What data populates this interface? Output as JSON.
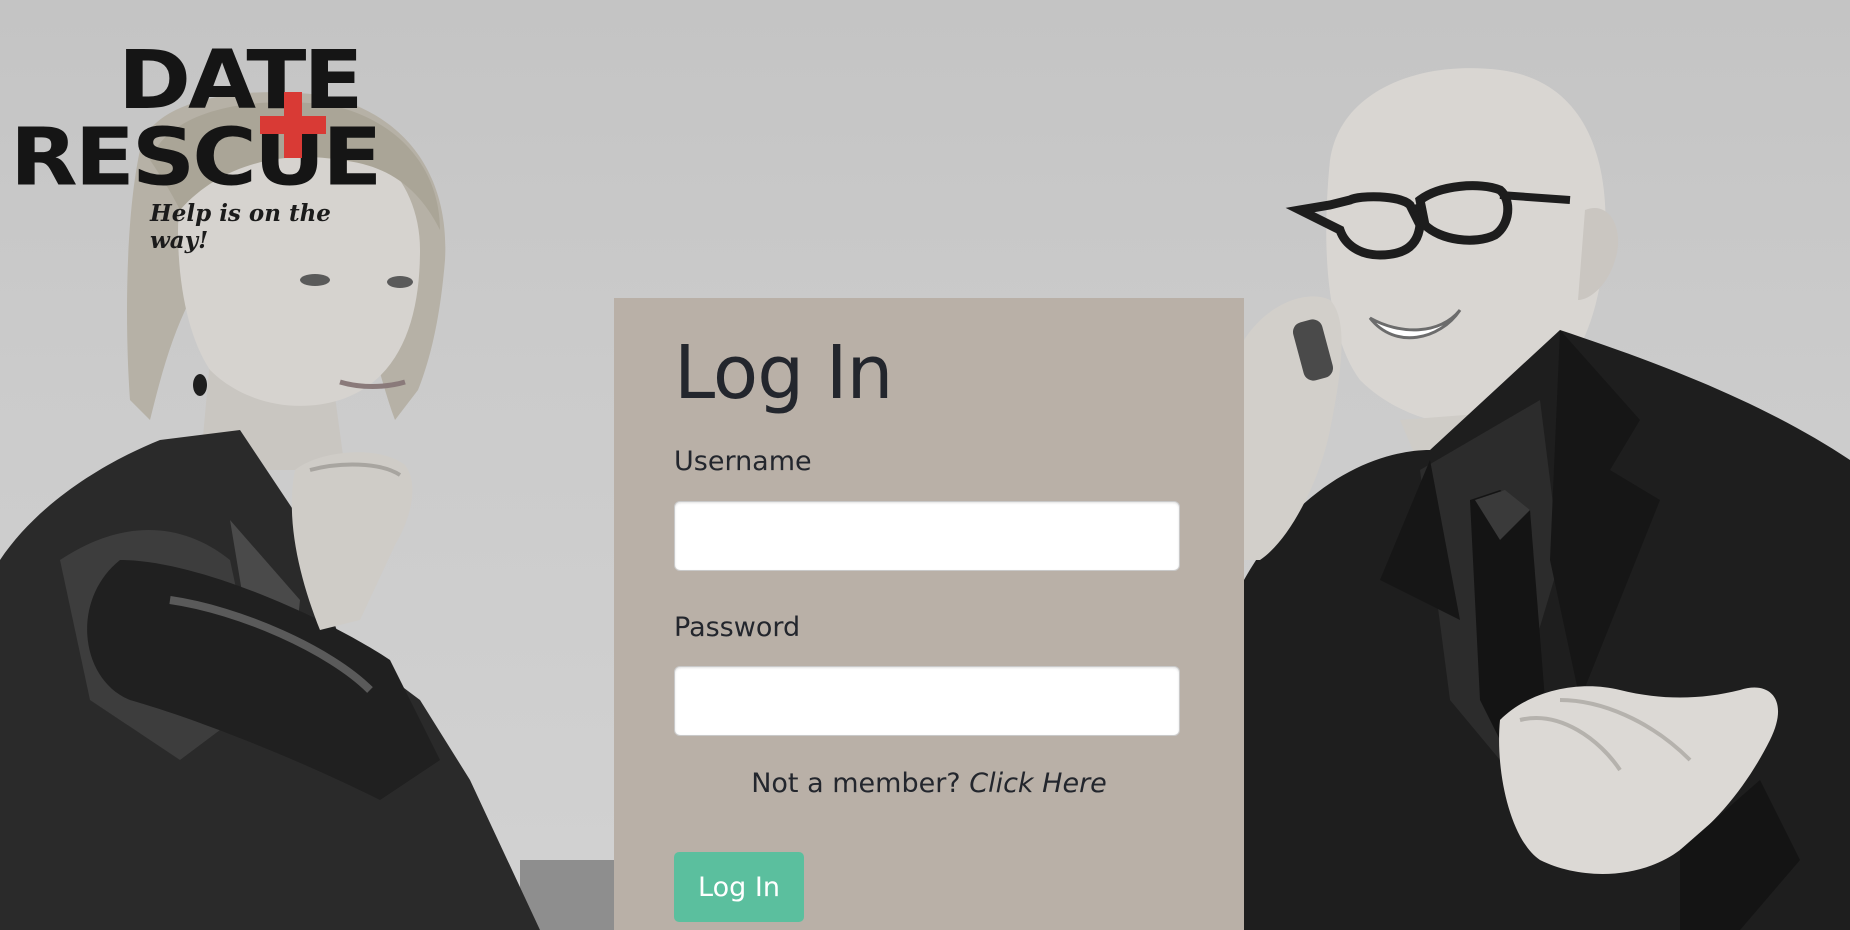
{
  "logo": {
    "line1": "DATE",
    "line2": "RESCUE",
    "tagline": "Help is on the way!",
    "accent_color": "#d93a35"
  },
  "background": {
    "description_left": "woman-thinking-photo",
    "description_right": "man-on-phone-photo"
  },
  "login": {
    "title": "Log In",
    "username_label": "Username",
    "username_value": "",
    "password_label": "Password",
    "password_value": "",
    "member_prompt": "Not a member?",
    "member_link": "Click Here",
    "submit_label": "Log In",
    "button_color": "#5bbf9e",
    "panel_color": "#b9b0a7"
  }
}
